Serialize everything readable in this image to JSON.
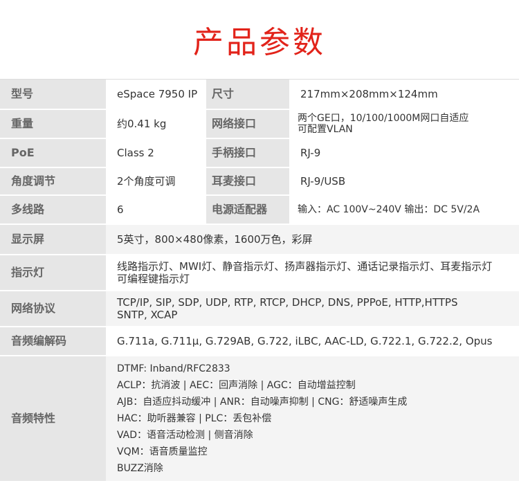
{
  "title": "产品参数",
  "spec_rows_two_col": [
    {
      "k1": "型号",
      "v1": "eSpace 7950 IP",
      "k2": "尺寸",
      "v2": "217mm×208mm×124mm"
    },
    {
      "k1": "重量",
      "v1": "约0.41 kg",
      "k2": "网络接口",
      "v2": "两个GE口，10/100/1000M网口自适应\n可配置VLAN"
    },
    {
      "k1": "PoE",
      "v1": "Class 2",
      "k2": "手柄接口",
      "v2": "RJ-9"
    },
    {
      "k1": "角度调节",
      "v1": "2个角度可调",
      "k2": "耳麦接口",
      "v2": "RJ-9/USB"
    },
    {
      "k1": "多线路",
      "v1": "6",
      "k2": "电源适配器",
      "v2": "输入：AC 100V~240V  输出：DC 5V/2A"
    }
  ],
  "display": {
    "label": "显示屏",
    "value": "5英寸，800×480像素，1600万色，彩屏"
  },
  "indicator": {
    "label": "指示灯",
    "line1": "线路指示灯、MWI灯、静音指示灯、扬声器指示灯、通话记录指示灯、耳麦指示灯",
    "line2": "可编程键指示灯"
  },
  "protocol": {
    "label": "网络协议",
    "line1": "TCP/IP, SIP, SDP, UDP, RTP, RTCP, DHCP, DNS, PPPoE, HTTP,HTTPS",
    "line2": "SNTP, XCAP"
  },
  "codec": {
    "label": "音频编解码",
    "value": "G.711a, G.711μ, G.729AB, G.722, iLBC, AAC-LD, G.722.1, G.722.2, Opus"
  },
  "audio": {
    "label": "音频特性",
    "lines": [
      "DTMF: Inband/RFC2833",
      "ACLP：抗消波 |  AEC：回声消除 |  AGC：自动增益控制",
      "AJB：自适应抖动缓冲 |  ANR：自动噪声抑制 |   CNG：舒适噪声生成",
      "HAC：助听器兼容 |  PLC：丢包补偿",
      "VAD：语音活动检测 |  侧音消除",
      "VQM：语音质量监控",
      "BUZZ消除"
    ]
  }
}
